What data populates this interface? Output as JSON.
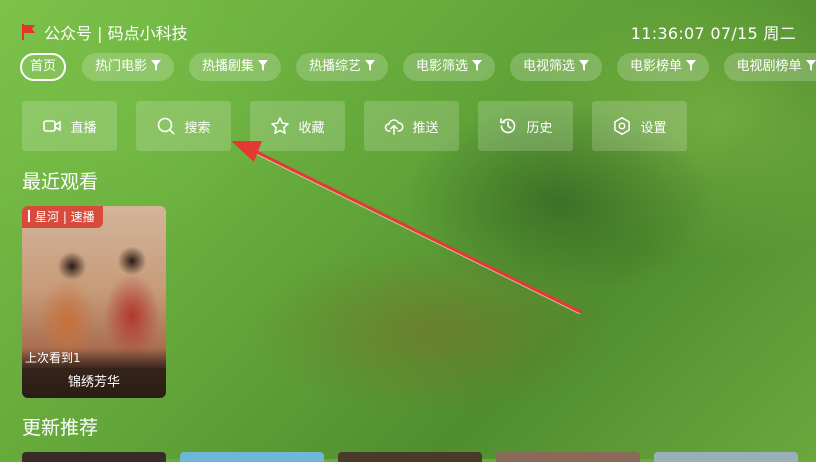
{
  "header": {
    "brand": "公众号 | 码点小科技",
    "clock": "11:36:07 07/15 周二"
  },
  "categories": [
    {
      "label": "首页",
      "active": true,
      "filter": false
    },
    {
      "label": "热门电影",
      "filter": true
    },
    {
      "label": "热播剧集",
      "filter": true
    },
    {
      "label": "热播综艺",
      "filter": true
    },
    {
      "label": "电影筛选",
      "filter": true
    },
    {
      "label": "电视筛选",
      "filter": true
    },
    {
      "label": "电影榜单",
      "filter": true
    },
    {
      "label": "电视剧榜单",
      "filter": true
    }
  ],
  "actions": [
    {
      "label": "直播",
      "icon": "video-camera-icon"
    },
    {
      "label": "搜索",
      "icon": "search-icon"
    },
    {
      "label": "收藏",
      "icon": "star-icon"
    },
    {
      "label": "推送",
      "icon": "cloud-upload-icon"
    },
    {
      "label": "历史",
      "icon": "history-icon"
    },
    {
      "label": "设置",
      "icon": "settings-icon"
    }
  ],
  "recent": {
    "title": "最近观看",
    "items": [
      {
        "badge": "星河 | 速播",
        "progress": "上次看到1",
        "title": "锦绣芳华"
      }
    ]
  },
  "updates": {
    "title": "更新推荐"
  },
  "colors": {
    "accent_red": "#e8322e",
    "badge_red": "#d84a3a",
    "chip_bg": "rgba(255,255,255,0.20)"
  }
}
